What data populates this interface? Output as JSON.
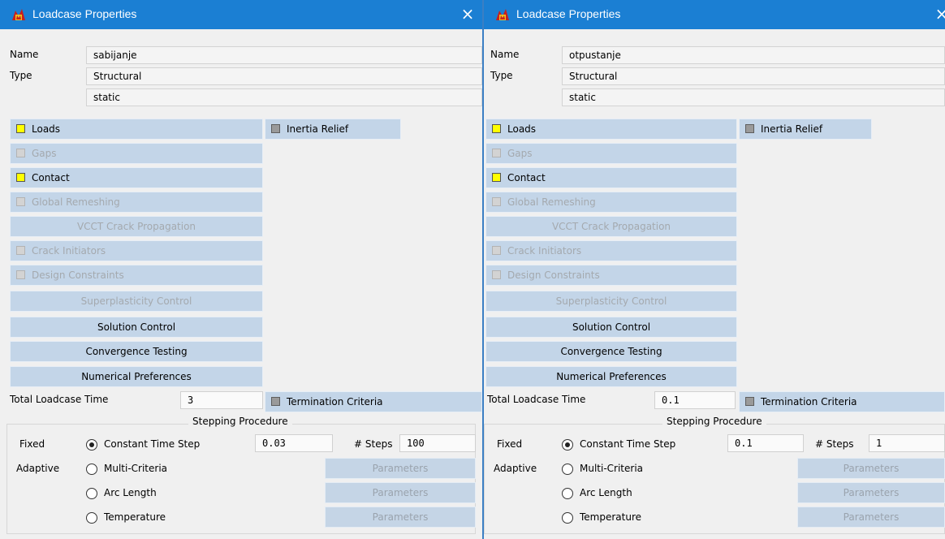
{
  "accent": "#1b7fd3",
  "dialogs": {
    "left": {
      "title": "Loadcase Properties",
      "close_icon": "×",
      "name_label": "Name",
      "name_value": "sabijanje",
      "type_label": "Type",
      "type_value": "Structural",
      "subtype_value": "static",
      "loads": "Loads",
      "inertia_relief": "Inertia Relief",
      "gaps": "Gaps",
      "contact": "Contact",
      "global_remeshing": "Global Remeshing",
      "vcct": "VCCT Crack Propagation",
      "crack_initiators": "Crack Initiators",
      "design_constraints": "Design Constraints",
      "superplasticity": "Superplasticity Control",
      "solution_control": "Solution Control",
      "convergence_testing": "Convergence Testing",
      "numerical_preferences": "Numerical Preferences",
      "total_time_label": "Total Loadcase Time",
      "total_time_value": "3",
      "termination_criteria": "Termination Criteria",
      "stepping_title": "Stepping Procedure",
      "fixed_label": "Fixed",
      "adaptive_label": "Adaptive",
      "constant_time_step": "Constant Time Step",
      "time_step_value": "0.03",
      "steps_label": "# Steps",
      "steps_value": "100",
      "multi_criteria": "Multi-Criteria",
      "arc_length": "Arc Length",
      "temperature": "Temperature",
      "parameters": "Parameters"
    },
    "right": {
      "title": "Loadcase Properties",
      "close_icon": "×",
      "name_label": "Name",
      "name_value": "otpustanje",
      "type_label": "Type",
      "type_value": "Structural",
      "subtype_value": "static",
      "loads": "Loads",
      "inertia_relief": "Inertia Relief",
      "gaps": "Gaps",
      "contact": "Contact",
      "global_remeshing": "Global Remeshing",
      "vcct": "VCCT Crack Propagation",
      "crack_initiators": "Crack Initiators",
      "design_constraints": "Design Constraints",
      "superplasticity": "Superplasticity Control",
      "solution_control": "Solution Control",
      "convergence_testing": "Convergence Testing",
      "numerical_preferences": "Numerical Preferences",
      "total_time_label": "Total Loadcase Time",
      "total_time_value": "0.1",
      "termination_criteria": "Termination Criteria",
      "stepping_title": "Stepping Procedure",
      "fixed_label": "Fixed",
      "adaptive_label": "Adaptive",
      "constant_time_step": "Constant Time Step",
      "time_step_value": "0.1",
      "steps_label": "# Steps",
      "steps_value": "1",
      "multi_criteria": "Multi-Criteria",
      "arc_length": "Arc Length",
      "temperature": "Temperature",
      "parameters": "Parameters"
    }
  }
}
